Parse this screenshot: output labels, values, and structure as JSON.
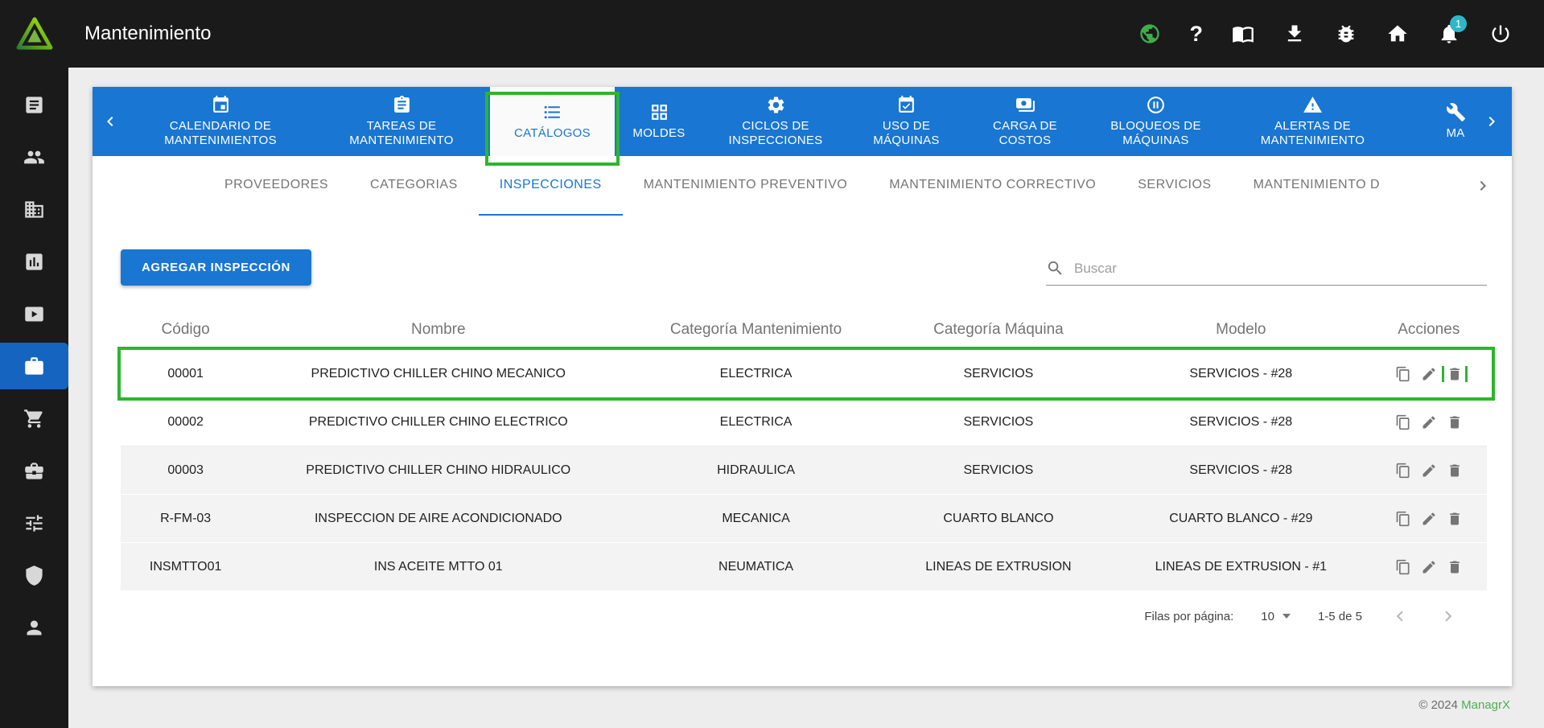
{
  "colors": {
    "accent_blue": "#1976d2",
    "annotation_green": "#2eb52e",
    "brand_green": "#4caf50",
    "sidebar_active_blue": "#1565c0"
  },
  "topbar": {
    "title": "Mantenimiento",
    "help_glyph": "?",
    "notification_badge": "1",
    "icons": [
      "globe-icon",
      "help-icon",
      "book-icon",
      "download-icon",
      "bug-icon",
      "home-icon",
      "notifications-icon",
      "power-icon"
    ]
  },
  "sidebar": {
    "icons": [
      "article-icon",
      "group-icon",
      "building-icon",
      "chart-icon",
      "display-icon",
      "maintenance-icon",
      "cart-icon",
      "briefcase-icon",
      "tune-icon",
      "shield-icon",
      "person-icon"
    ],
    "active_icon": "maintenance-icon"
  },
  "nav": {
    "active_tab": "CATÁLOGOS",
    "tabs": [
      {
        "label": "CALENDARIO DE MANTENIMIENTOS",
        "icon": "calendar-icon"
      },
      {
        "label": "TAREAS DE MANTENIMIENTO",
        "icon": "tasks-icon"
      },
      {
        "label": "CATÁLOGOS",
        "icon": "list-icon"
      },
      {
        "label": "MOLDES",
        "icon": "grid-icon"
      },
      {
        "label": "CICLOS DE INSPECCIONES",
        "icon": "gear-icon"
      },
      {
        "label": "USO DE MÁQUINAS",
        "icon": "calendar-check-icon"
      },
      {
        "label": "CARGA DE COSTOS",
        "icon": "payments-icon"
      },
      {
        "label": "BLOQUEOS DE MÁQUINAS",
        "icon": "pause-circle-icon"
      },
      {
        "label": "ALERTAS DE MANTENIMIENTO",
        "icon": "alert-icon"
      },
      {
        "label": "MA",
        "icon": "build-icon"
      }
    ]
  },
  "subtabs": {
    "active": "INSPECCIONES",
    "items": [
      "PROVEEDORES",
      "CATEGORIAS",
      "INSPECCIONES",
      "MANTENIMIENTO PREVENTIVO",
      "MANTENIMIENTO CORRECTIVO",
      "SERVICIOS",
      "MANTENIMIENTO D"
    ]
  },
  "toolbar": {
    "add_button": "AGREGAR INSPECCIÓN",
    "search_placeholder": "Buscar"
  },
  "table": {
    "columns": [
      "Código",
      "Nombre",
      "Categoría Mantenimiento",
      "Categoría Máquina",
      "Modelo",
      "Acciones"
    ],
    "action_icons": [
      "copy-icon",
      "edit-icon",
      "delete-icon"
    ],
    "rows": [
      {
        "codigo": "00001",
        "nombre": "PREDICTIVO CHILLER CHINO MECANICO",
        "cat_mant": "ELECTRICA",
        "cat_maq": "SERVICIOS",
        "modelo": "SERVICIOS - #28"
      },
      {
        "codigo": "00002",
        "nombre": "PREDICTIVO CHILLER CHINO ELECTRICO",
        "cat_mant": "ELECTRICA",
        "cat_maq": "SERVICIOS",
        "modelo": "SERVICIOS - #28"
      },
      {
        "codigo": "00003",
        "nombre": "PREDICTIVO CHILLER CHINO HIDRAULICO",
        "cat_mant": "HIDRAULICA",
        "cat_maq": "SERVICIOS",
        "modelo": "SERVICIOS - #28"
      },
      {
        "codigo": "R-FM-03",
        "nombre": "INSPECCION DE AIRE ACONDICIONADO",
        "cat_mant": "MECANICA",
        "cat_maq": "CUARTO BLANCO",
        "modelo": "CUARTO BLANCO - #29"
      },
      {
        "codigo": "INSMTTO01",
        "nombre": "INS ACEITE MTTO 01",
        "cat_mant": "NEUMATICA",
        "cat_maq": "LINEAS DE EXTRUSION",
        "modelo": "LINEAS DE EXTRUSION - #1"
      }
    ]
  },
  "pagination": {
    "rows_per_page_label": "Filas por página:",
    "rows_per_page_value": "10",
    "range_label": "1-5 de 5"
  },
  "footer": {
    "copyright": "© 2024",
    "brand": "ManagrX"
  },
  "annotations": {
    "highlighted_tab": "CATÁLOGOS",
    "highlighted_row_codigo": "00001",
    "arrow_target": "delete-icon"
  }
}
